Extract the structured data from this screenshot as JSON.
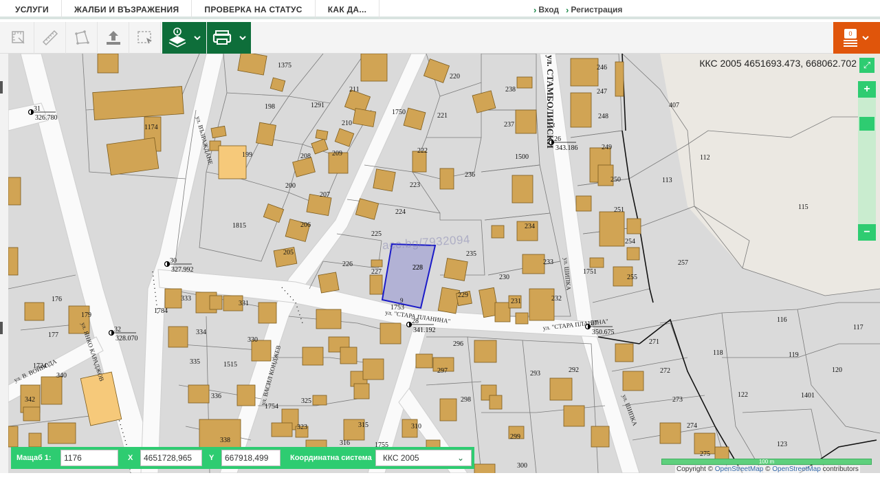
{
  "nav": {
    "tabs": [
      "УСЛУГИ",
      "ЖАЛБИ И ВЪЗРАЖЕНИЯ",
      "ПРОВЕРКА НА СТАТУС",
      "КАК ДА..."
    ],
    "login_label": "Вход",
    "register_label": "Регистрация"
  },
  "toolbar": {
    "tools": [
      {
        "icon": "measure-area-icon"
      },
      {
        "icon": "ruler-icon"
      },
      {
        "icon": "polygon-icon"
      },
      {
        "icon": "upload-icon"
      },
      {
        "icon": "select-rectangle-icon"
      }
    ],
    "info_icon": "layers-info-icon",
    "print_icon": "printer-icon",
    "cart_count": "0",
    "accent_color": "#0e6e3a",
    "orange_color": "#e0550b"
  },
  "map": {
    "coordinate_readout": "ККС 2005 4651693.473, 668062.702",
    "watermark": "acc.bg/7932094",
    "selected_parcel": {
      "number": "228",
      "sub": "9"
    },
    "street_labels": [
      "ул. ЯНКО КАРАДЖОВ",
      "ул. ВЪЗРАЖДАНЕ",
      "ул. \"СТАРА ПЛАНИНА\"",
      "ул. \"СТАРА ПЛАНИНА\"",
      "ул. СТАМБОЛИЙСКИ",
      "ул. ШИПКА",
      "ул. ШИПКА",
      "ул. ВАСИЛ КОНДЖЕВ",
      "ул. В. ВОЙВОДА"
    ],
    "geodetic_points": [
      {
        "id": "31",
        "elev": "326.780"
      },
      {
        "id": "30",
        "elev": "327.992"
      },
      {
        "id": "32",
        "elev": "328.070"
      },
      {
        "id": "28",
        "elev": "341.192"
      },
      {
        "id": "26",
        "elev": "343.186"
      },
      {
        "id": "27",
        "elev": "350.675"
      }
    ],
    "parcels": [
      "1375",
      "198",
      "1291",
      "211",
      "210",
      "209",
      "208",
      "207",
      "206",
      "205",
      "200",
      "199",
      "1815",
      "1174",
      "220",
      "221",
      "222",
      "223",
      "224",
      "225",
      "226",
      "227",
      "228",
      "229",
      "230",
      "231",
      "232",
      "233",
      "234",
      "235",
      "236",
      "237",
      "238",
      "1500",
      "1750",
      "246",
      "247",
      "248",
      "249",
      "250",
      "251",
      "254",
      "255",
      "257",
      "1751",
      "407",
      "112",
      "113",
      "115",
      "116",
      "117",
      "118",
      "119",
      "120",
      "122",
      "123",
      "1401",
      "271",
      "272",
      "273",
      "274",
      "275",
      "292",
      "293",
      "296",
      "297",
      "298",
      "299",
      "300",
      "310",
      "315",
      "316",
      "323",
      "325",
      "330",
      "331",
      "333",
      "334",
      "335",
      "336",
      "338",
      "340",
      "342",
      "176",
      "177",
      "179",
      "1724",
      "1515",
      "1754",
      "1753",
      "1755",
      "1784"
    ]
  },
  "controls": {
    "scale_label": "Мащаб  1:",
    "scale_value": "1176",
    "x_label": "X",
    "x_value": "4651728,965",
    "y_label": "Y",
    "y_value": "667918,499",
    "crs_label": "Координатна система",
    "crs_value": "ККС 2005",
    "zoom_in": "+",
    "zoom_out": "−"
  },
  "scalebar_label": "100 m",
  "attribution": {
    "prefix": "Copyright © ",
    "osm1": "OpenStreetMap",
    "middle": " © ",
    "osm2": "OpenStreetMap",
    "suffix": " contributors"
  }
}
